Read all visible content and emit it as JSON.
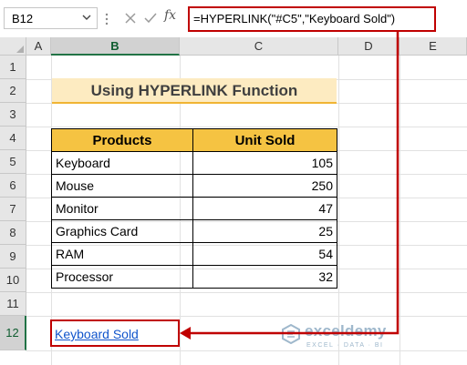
{
  "formula_bar": {
    "name_box": "B12",
    "formula": "=HYPERLINK(\"#C5\",\"Keyboard Sold\")",
    "fx_label": "fx",
    "cancel_icon": "close-icon",
    "enter_icon": "check-icon"
  },
  "columns": [
    "A",
    "B",
    "C",
    "D",
    "E"
  ],
  "rows": [
    "1",
    "2",
    "3",
    "4",
    "5",
    "6",
    "7",
    "8",
    "9",
    "10",
    "11",
    "12"
  ],
  "selected_cell": {
    "column": "B",
    "row": "12"
  },
  "sheet": {
    "title": "Using HYPERLINK Function",
    "table": {
      "headers": [
        "Products",
        "Unit Sold"
      ],
      "rows": [
        [
          "Keyboard",
          "105"
        ],
        [
          "Mouse",
          "250"
        ],
        [
          "Monitor",
          "47"
        ],
        [
          "Graphics Card",
          "25"
        ],
        [
          "RAM",
          "54"
        ],
        [
          "Processor",
          "32"
        ]
      ]
    },
    "hyperlink_text": "Keyboard Sold"
  },
  "watermark": {
    "name": "exceldemy",
    "tagline": "EXCEL · DATA · BI"
  },
  "colors": {
    "accent_red": "#c00000",
    "header_fill": "#f5c342",
    "title_fill": "#fdebc1",
    "link": "#1155cc"
  }
}
